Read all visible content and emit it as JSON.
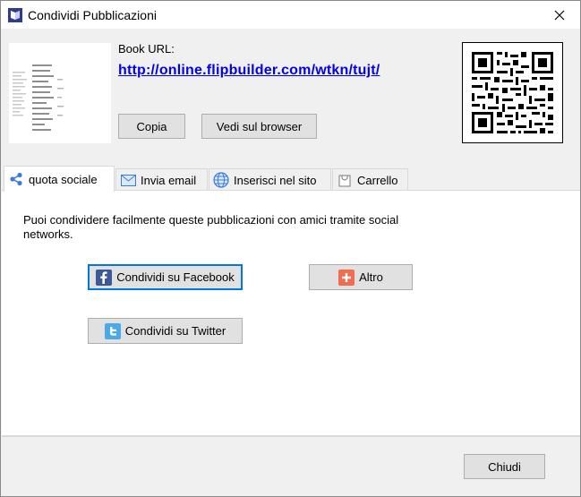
{
  "window": {
    "title": "Condividi Pubblicazioni"
  },
  "book": {
    "url_label": "Book URL:",
    "url": "http://online.flipbuilder.com/wtkn/tujt/",
    "copy_label": "Copia",
    "browser_label": "Vedi sul browser"
  },
  "tabs": [
    {
      "label": "quota sociale",
      "icon": "share-icon",
      "active": true
    },
    {
      "label": "Invia email",
      "icon": "email-icon",
      "active": false
    },
    {
      "label": "Inserisci nel sito",
      "icon": "globe-icon",
      "active": false
    },
    {
      "label": "Carrello",
      "icon": "cart-icon",
      "active": false
    }
  ],
  "social": {
    "description": "Puoi condividere facilmente queste pubblicazioni con amici tramite social networks.",
    "facebook_label": "Condividi su Facebook",
    "twitter_label": "Condividi su Twitter",
    "more_label": "Altro"
  },
  "footer": {
    "close_label": "Chiudi"
  },
  "colors": {
    "link": "#0000ee",
    "accent": "#0078d7",
    "facebook": "#3b5998",
    "twitter": "#1da1f2",
    "more": "#f26c4f"
  }
}
